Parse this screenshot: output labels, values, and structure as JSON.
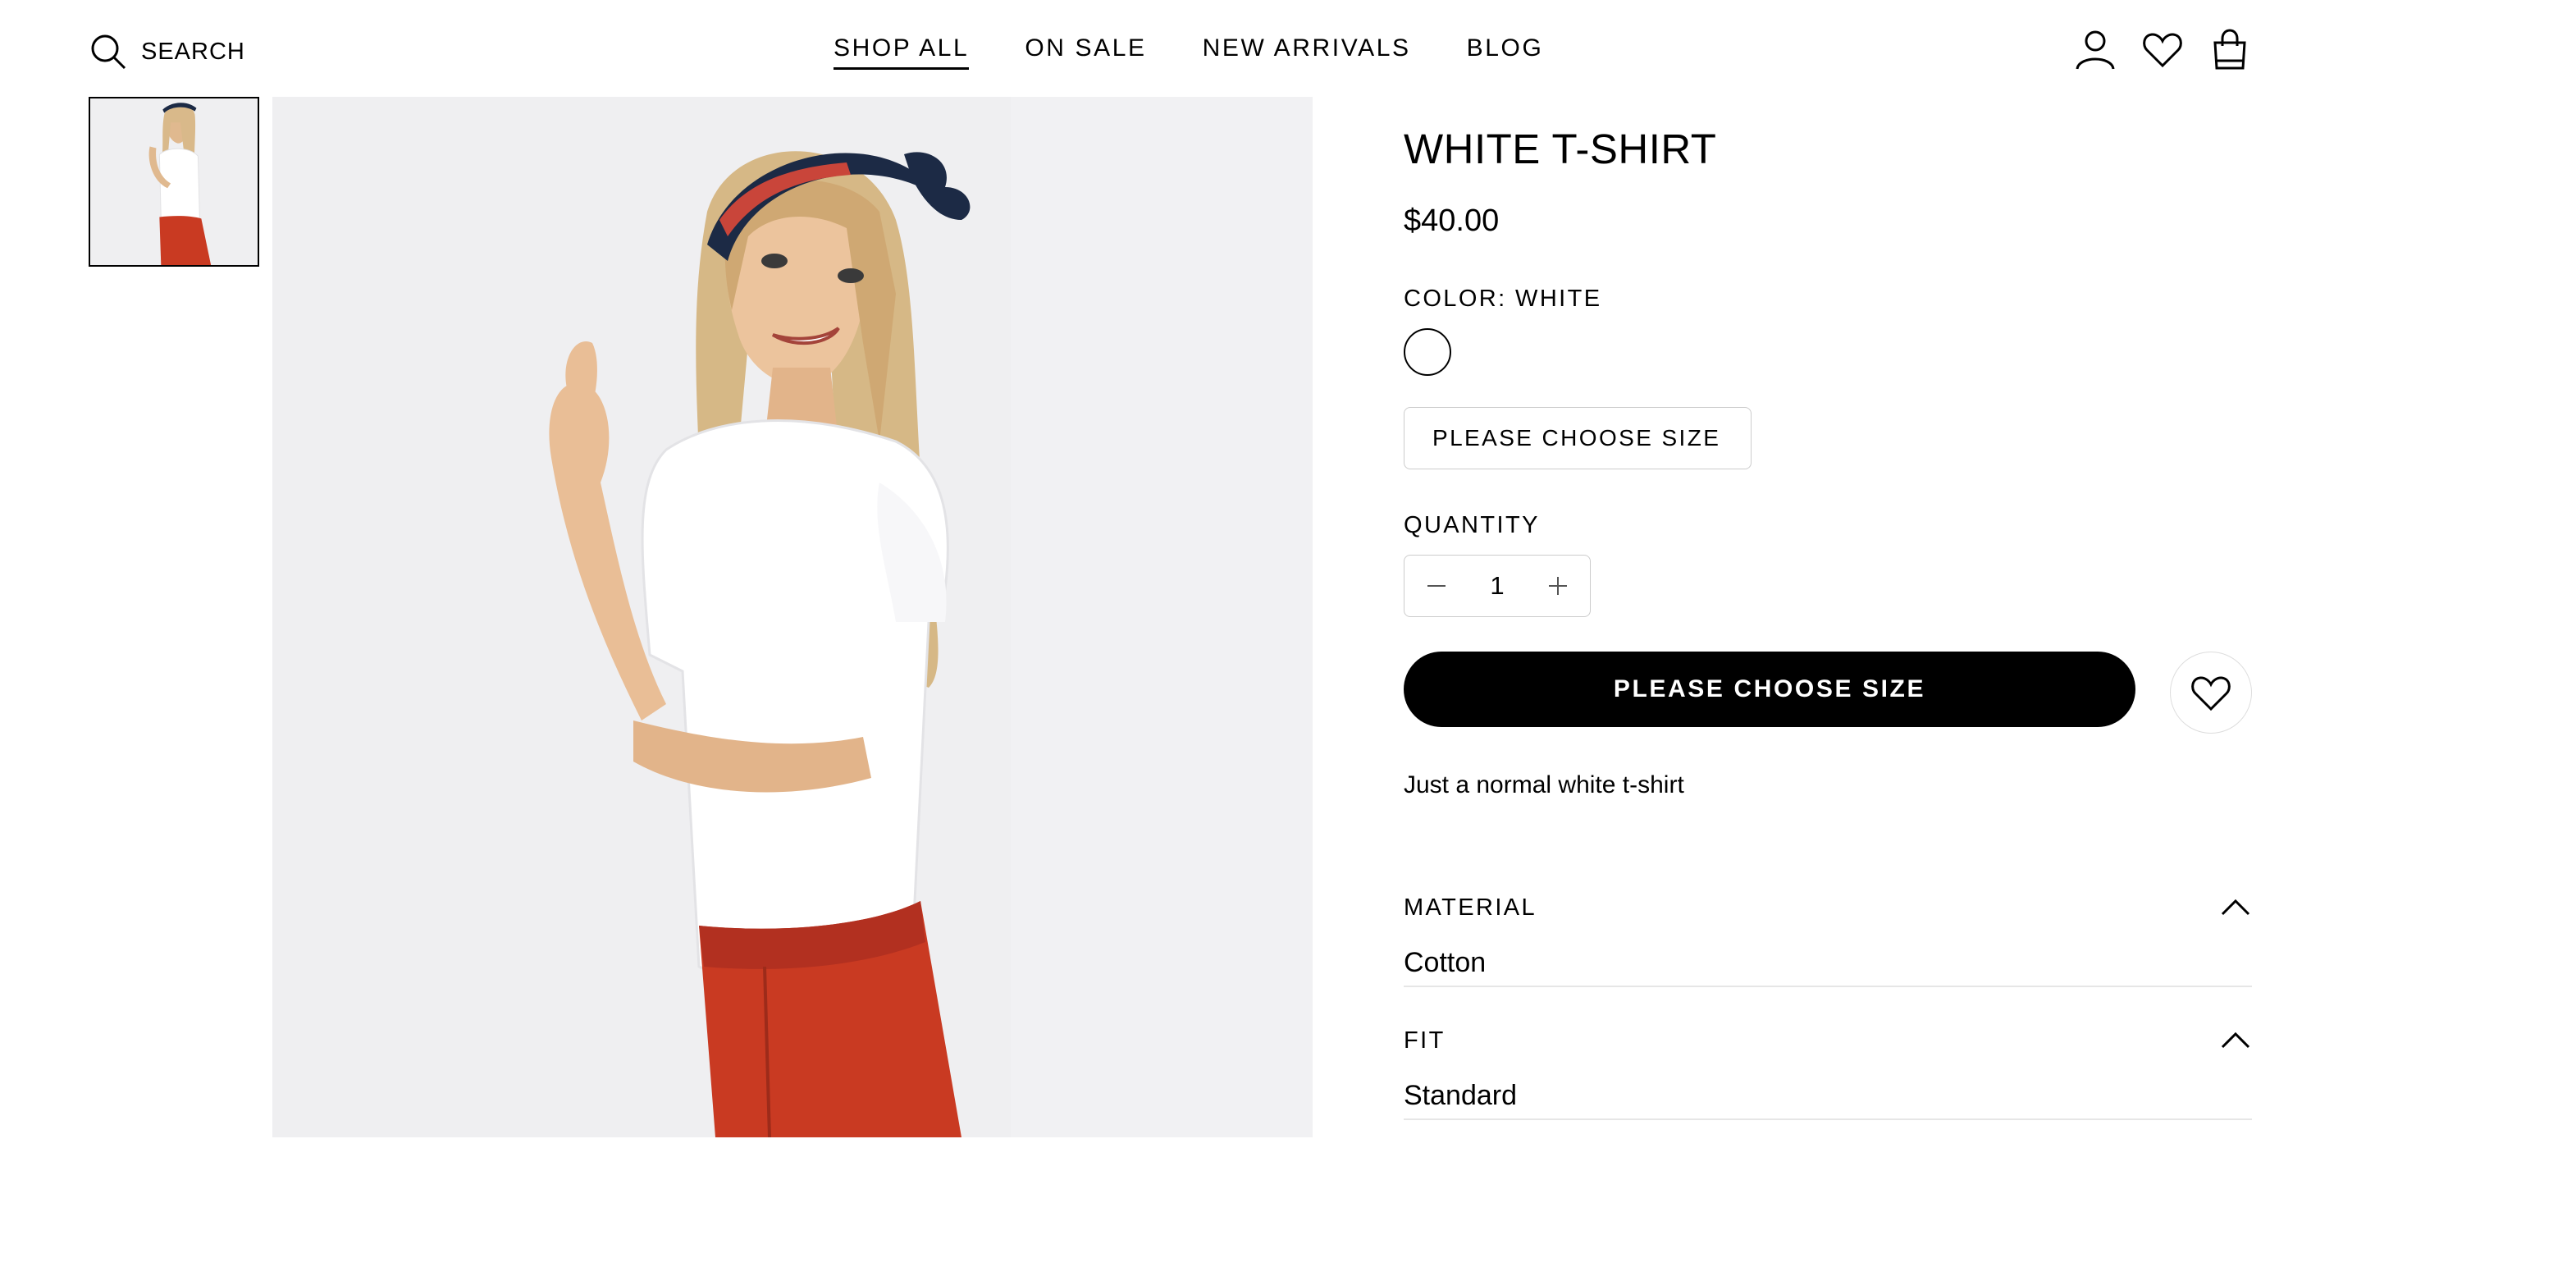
{
  "header": {
    "search_label": "SEARCH",
    "nav": [
      {
        "label": "SHOP ALL",
        "active": true
      },
      {
        "label": "ON SALE",
        "active": false
      },
      {
        "label": "NEW ARRIVALS",
        "active": false
      },
      {
        "label": "BLOG",
        "active": false
      }
    ],
    "icons": [
      "account-icon",
      "wishlist-icon",
      "cart-icon"
    ]
  },
  "gallery": {
    "thumbnails": 1,
    "background_color": "#efeff1"
  },
  "product": {
    "title": "WHITE T-SHIRT",
    "price": "$40.00",
    "color_label": "COLOR: WHITE",
    "swatch_color": "#ffffff",
    "size_placeholder": "PLEASE CHOOSE SIZE",
    "quantity_label": "QUANTITY",
    "quantity": "1",
    "add_button_label": "PLEASE CHOOSE SIZE",
    "description": "Just a normal white t-shirt",
    "accordions": [
      {
        "label": "MATERIAL",
        "value": "Cotton",
        "expanded": true
      },
      {
        "label": "FIT",
        "value": "Standard",
        "expanded": true
      }
    ]
  }
}
